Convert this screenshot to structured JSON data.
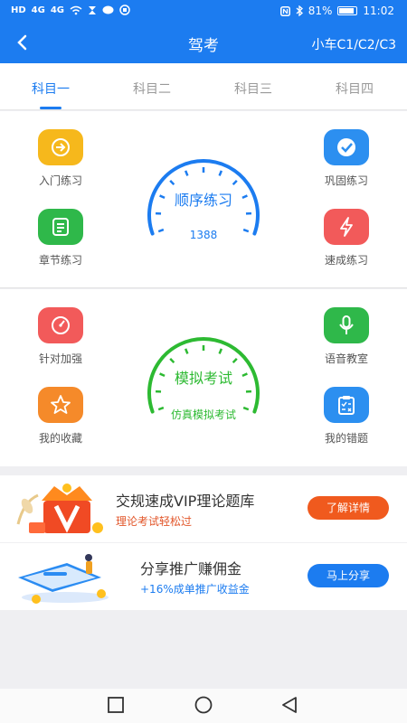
{
  "status_bar": {
    "left_chips": [
      "HD",
      "4G",
      "4G"
    ],
    "battery": "81%",
    "time": "11:02"
  },
  "nav": {
    "back_icon": "chevron-left-icon",
    "title": "驾考",
    "right_label": "小车C1/C2/C3"
  },
  "tabs": [
    {
      "label": "科目一",
      "active": true
    },
    {
      "label": "科目二",
      "active": false
    },
    {
      "label": "科目三",
      "active": false
    },
    {
      "label": "科目四",
      "active": false
    }
  ],
  "practice": {
    "left": [
      {
        "label": "入门练习",
        "icon": "login-arrow-icon",
        "color": "#f6b81c"
      },
      {
        "label": "章节练习",
        "icon": "list-document-icon",
        "color": "#2fb84a"
      }
    ],
    "right": [
      {
        "label": "巩固练习",
        "icon": "checkmark-icon",
        "color": "#2c8ff0"
      },
      {
        "label": "速成练习",
        "icon": "lightning-icon",
        "color": "#f25a5a"
      }
    ],
    "gauge_title": "顺序练习",
    "gauge_sub": "1388",
    "gauge_color": "#1c7cf0"
  },
  "exam": {
    "left": [
      {
        "label": "针对加强",
        "icon": "gauge-icon",
        "color": "#f25a5a"
      },
      {
        "label": "我的收藏",
        "icon": "star-icon",
        "color": "#f58a2a"
      }
    ],
    "right": [
      {
        "label": "语音教室",
        "icon": "microphone-icon",
        "color": "#2fb84a"
      },
      {
        "label": "我的错题",
        "icon": "clipboard-icon",
        "color": "#2c8ff0"
      }
    ],
    "gauge_title": "模拟考试",
    "gauge_sub": "仿真模拟考试",
    "gauge_color": "#2dba32"
  },
  "banners": [
    {
      "title": "交规速成VIP理论题库",
      "subtitle": "理论考试轻松过",
      "button": "了解详情",
      "subtitle_color": "#e2562a",
      "button_color": "#f05a1e"
    },
    {
      "title": "分享推广赚佣金",
      "subtitle": "+16%成单推广收益金",
      "button": "马上分享",
      "subtitle_color": "#1c7cf0",
      "button_color": "#1c7cf0"
    }
  ],
  "bottom_nav": [
    "recent-apps-icon",
    "home-icon",
    "back-triangle-icon"
  ]
}
